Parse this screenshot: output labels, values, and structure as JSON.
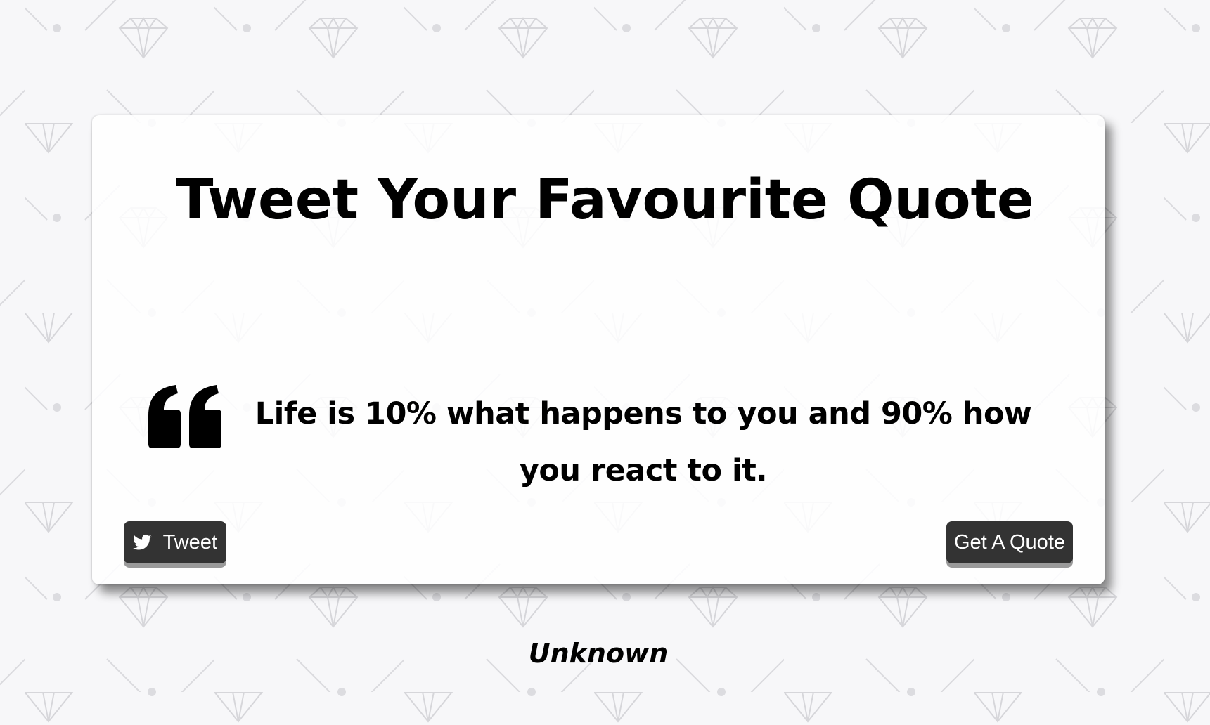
{
  "title": "Tweet Your Favourite Quote",
  "quote": {
    "text": "Life is 10% what happens to you and 90% how you react to it.",
    "author": "Unknown",
    "icon": "quote-left-icon"
  },
  "buttons": {
    "tweet_label": "Tweet",
    "tweet_icon": "twitter-icon",
    "new_quote_label": "Get A Quote"
  },
  "colors": {
    "background": "#f7f7f9",
    "pattern": "#d6d6da",
    "card": "#ffffff",
    "button": "#333333",
    "button_text": "#ffffff",
    "text": "#000000"
  }
}
